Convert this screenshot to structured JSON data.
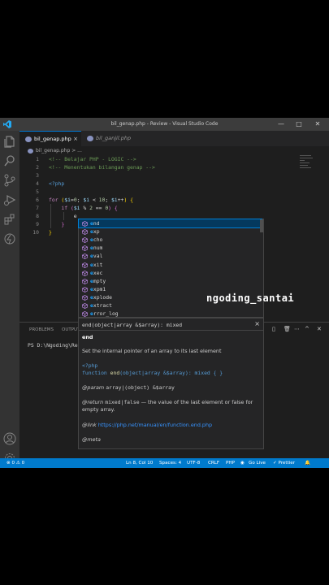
{
  "titlebar": {
    "title": "bil_genap.php - Review - Visual Studio Code",
    "min": "—",
    "max": "□",
    "close": "✕"
  },
  "tabs": [
    {
      "label": "bil_genap.php",
      "close": "×"
    },
    {
      "label": "bil_ganjil.php"
    }
  ],
  "breadcrumb": {
    "file": "bil_genap.php",
    "sep": ">",
    "more": "..."
  },
  "editor": {
    "lines": [
      {
        "n": "1",
        "html": "<span class='c-comment'>&lt;!-- Belajar PHP - LOGIC --&gt;</span>"
      },
      {
        "n": "2",
        "html": "<span class='c-comment'>&lt;!-- Menentukan bilangan genap --&gt;</span>"
      },
      {
        "n": "3",
        "html": ""
      },
      {
        "n": "4",
        "html": "<span class='c-tag'>&lt;?php</span>"
      },
      {
        "n": "5",
        "html": ""
      },
      {
        "n": "6",
        "html": "<span class='c-kw'>for</span> <span class='c-brace'>(</span><span class='c-var'>$i</span><span class='c-op'>=</span><span class='c-num'>0</span><span class='c-op'>; </span><span class='c-var'>$i</span><span class='c-op'> &lt; </span><span class='c-num'>10</span><span class='c-op'>; </span><span class='c-var'>$i</span><span class='c-op'>++</span><span class='c-brace'>)</span> <span class='c-brace'>{</span>"
      },
      {
        "n": "7",
        "html": "    <span class='c-kw'>if</span> <span class='c-paren'>(</span><span class='c-var'>$i</span><span class='c-op'> % </span><span class='c-num'>2</span><span class='c-op'> == </span><span class='c-num'>0</span><span class='c-paren'>)</span> <span class='c-paren'>{</span>"
      },
      {
        "n": "8",
        "html": "        <span class='c-op'>e</span>"
      },
      {
        "n": "9",
        "html": "    <span class='c-paren'>}</span>"
      },
      {
        "n": "10",
        "html": "<span class='c-brace'>}</span>"
      }
    ]
  },
  "suggestions": [
    {
      "label": "end",
      "match": "e",
      "rest": "nd",
      "selected": true
    },
    {
      "label": "exp",
      "match": "e",
      "rest": "xp"
    },
    {
      "label": "echo",
      "match": "e",
      "rest": "cho"
    },
    {
      "label": "enum",
      "match": "e",
      "rest": "num"
    },
    {
      "label": "eval",
      "match": "e",
      "rest": "val"
    },
    {
      "label": "exit",
      "match": "e",
      "rest": "xit"
    },
    {
      "label": "exec",
      "match": "e",
      "rest": "xec"
    },
    {
      "label": "empty",
      "match": "e",
      "rest": "mpty"
    },
    {
      "label": "expm1",
      "match": "e",
      "rest": "xpm1"
    },
    {
      "label": "explode",
      "match": "e",
      "rest": "xplode"
    },
    {
      "label": "extract",
      "match": "e",
      "rest": "xtract"
    },
    {
      "label": "error_log",
      "match": "e",
      "rest": "rror_log"
    }
  ],
  "details": {
    "signature": "end(object|array &$array): mixed",
    "close": "×",
    "name": "end",
    "description": "Set the internal pointer of an array to its last element",
    "code_tag": "<?php",
    "code_fn_kw": "function",
    "code_fn_name": "end",
    "code_fn_params": "(object|array &$array): mixed { }",
    "param_tag": "@param",
    "param_text": "array|(object) &$array",
    "return_tag": "@return",
    "return_type": "mixed|false",
    "return_text": " — the value of the last element or false for empty array.",
    "link_tag": "@link",
    "link_url": "https://php.net/manual/en/function.end.php",
    "meta_tag": "@meta"
  },
  "panel": {
    "problems": "PROBLEMS",
    "output": "OUTPUT",
    "terminal_prompt": "PS D:\\Ngoding\\Re"
  },
  "watermark": "ngoding_santai",
  "status": {
    "errors": "⊗ 0 ⚠ 0",
    "position": "Ln 8, Col 10",
    "spaces": "Spaces: 4",
    "encoding": "UTF-8",
    "eol": "CRLF",
    "language": "PHP",
    "golive": "Go Live",
    "prettier": "✓ Prettier"
  },
  "colors": {
    "accent": "#007acc",
    "selection": "#04395e",
    "editor_bg": "#1e1e1e"
  }
}
